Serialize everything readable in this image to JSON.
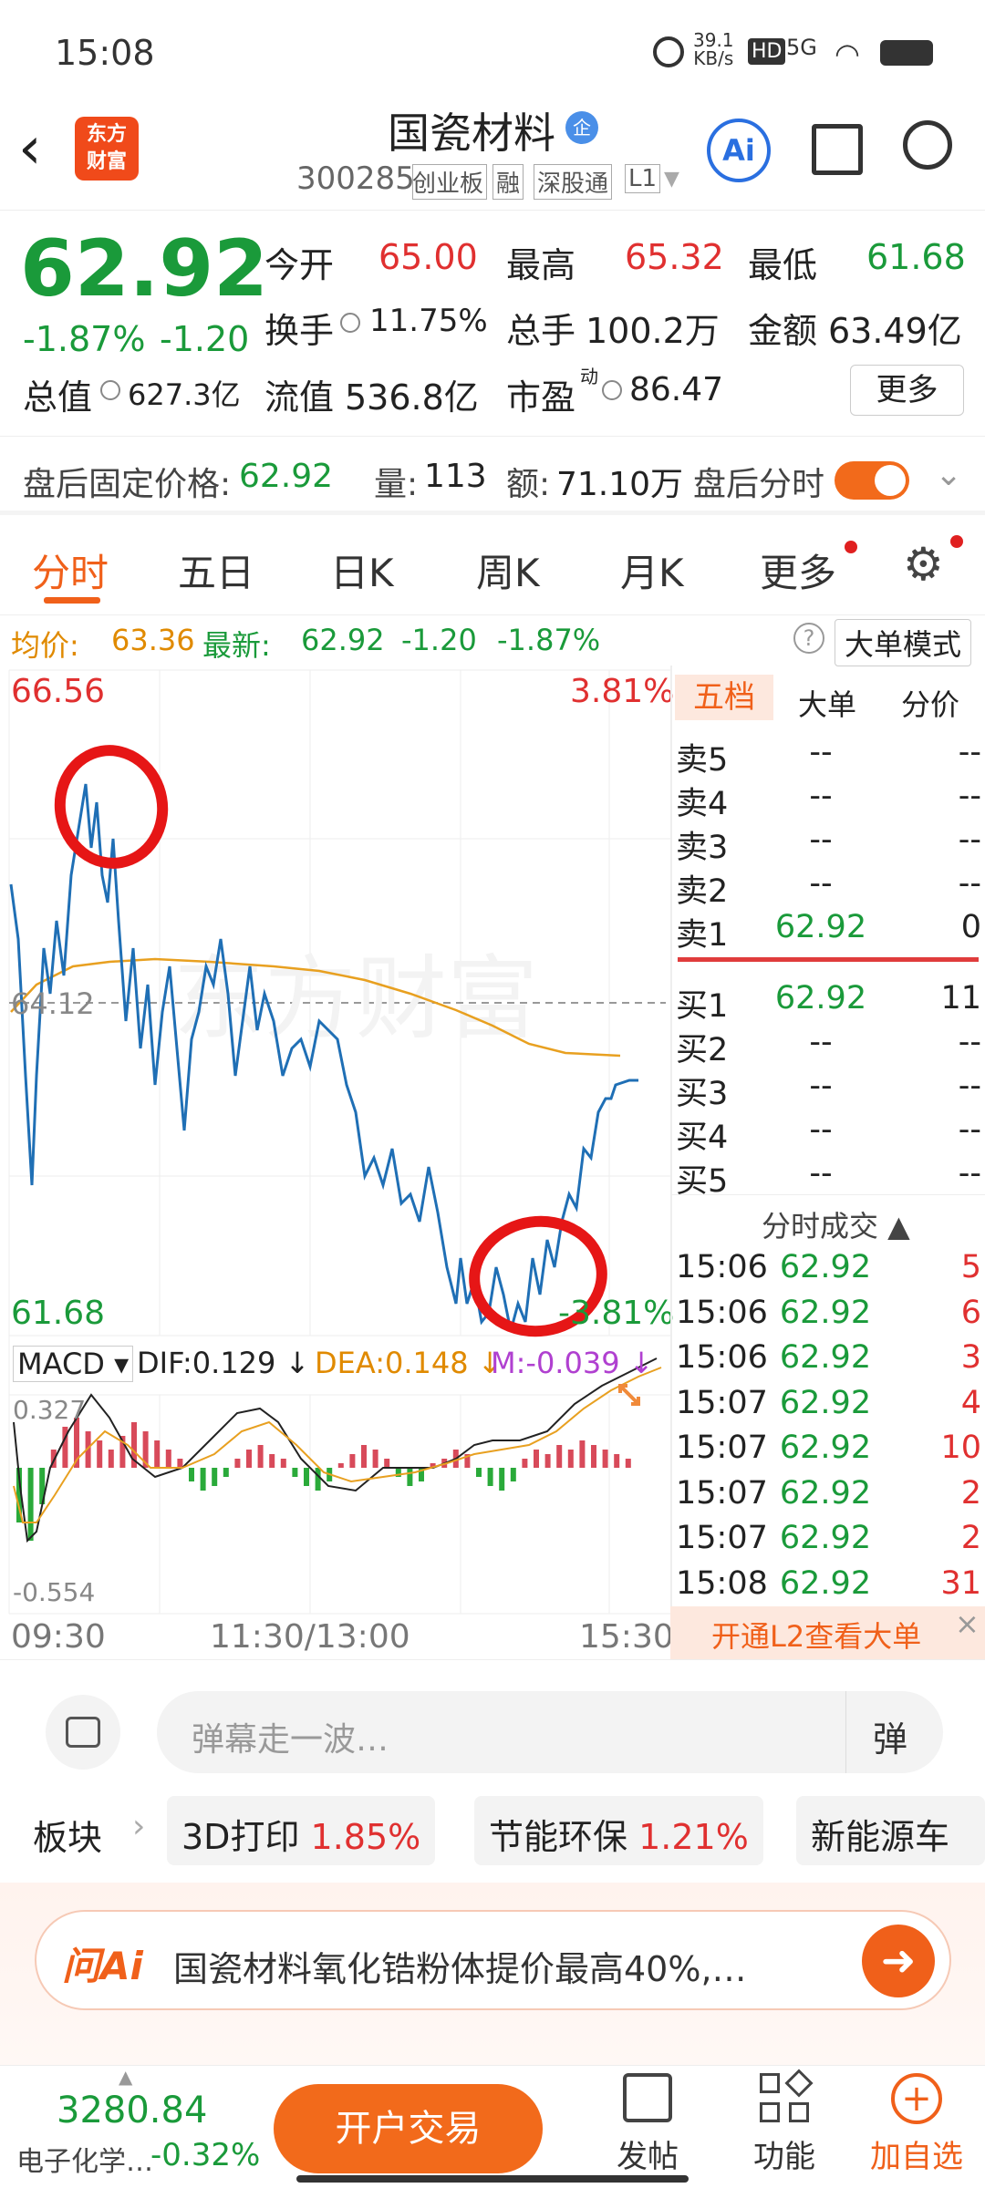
{
  "status": {
    "time": "15:08",
    "speed_value": "39.1",
    "speed_unit": "KB/s",
    "hd": "HD",
    "net": "5G"
  },
  "header": {
    "logo_line1": "东方",
    "logo_line2": "财富",
    "name": "国瓷材料",
    "name_badge": "企",
    "code": "300285",
    "tag1": "创业板",
    "tag2": "融",
    "tag3": "深股通",
    "tag4": "L1",
    "ai": "Ai"
  },
  "quote": {
    "price": "62.92",
    "pct": "-1.87%",
    "change": "-1.20",
    "open_label": "今开",
    "open": "65.00",
    "high_label": "最高",
    "high": "65.32",
    "low_label": "最低",
    "low": "61.68",
    "turnover_label": "换手",
    "turnover": "11.75%",
    "volume_label": "总手",
    "volume": "100.2万",
    "amount_label": "金额",
    "amount": "63.49亿",
    "mcap_label": "总值",
    "mcap": "627.3亿",
    "float_label": "流值",
    "float": "536.8亿",
    "pe_label": "市盈",
    "pe_sup": "动",
    "pe": "86.47",
    "more": "更多"
  },
  "after": {
    "label": "盘后固定价格:",
    "price": "62.92",
    "vol_label": "量:",
    "vol": "113",
    "amt_label": "额:",
    "amt": "71.10万",
    "toggle_label": "盘后分时"
  },
  "tabs": [
    "分时",
    "五日",
    "日K",
    "周K",
    "月K",
    "更多"
  ],
  "info": {
    "avg_label": "均价:",
    "avg": "63.36",
    "latest_label": "最新:",
    "latest": "62.92",
    "chg": "-1.20",
    "pct": "-1.87%",
    "mode": "大单模式"
  },
  "chart": {
    "max": "66.56",
    "max_pct": "3.81%",
    "min": "61.68",
    "min_pct": "-3.81%",
    "mid": "64.12",
    "watermark": "东方财富",
    "macd_label": "MACD",
    "dif": "DIF:0.129 ↓",
    "dea": "DEA:0.148 ↓",
    "m": "M:-0.039 ↓",
    "macd_top": "0.327",
    "macd_bottom": "-0.554",
    "t0": "09:30",
    "t1": "11:30/13:00",
    "t2": "15:30"
  },
  "book": {
    "tabs": [
      "五档",
      "大单",
      "分价"
    ],
    "asks": [
      {
        "l": "卖5",
        "p": "--",
        "v": "--"
      },
      {
        "l": "卖4",
        "p": "--",
        "v": "--"
      },
      {
        "l": "卖3",
        "p": "--",
        "v": "--"
      },
      {
        "l": "卖2",
        "p": "--",
        "v": "--"
      },
      {
        "l": "卖1",
        "p": "62.92",
        "v": "0"
      }
    ],
    "bids": [
      {
        "l": "买1",
        "p": "62.92",
        "v": "11"
      },
      {
        "l": "买2",
        "p": "--",
        "v": "--"
      },
      {
        "l": "买3",
        "p": "--",
        "v": "--"
      },
      {
        "l": "买4",
        "p": "--",
        "v": "--"
      },
      {
        "l": "买5",
        "p": "--",
        "v": "--"
      }
    ],
    "trades_title": "分时成交 ▲",
    "trades": [
      {
        "t": "15:06",
        "p": "62.92",
        "v": "5"
      },
      {
        "t": "15:06",
        "p": "62.92",
        "v": "6"
      },
      {
        "t": "15:06",
        "p": "62.92",
        "v": "3"
      },
      {
        "t": "15:07",
        "p": "62.92",
        "v": "4"
      },
      {
        "t": "15:07",
        "p": "62.92",
        "v": "10"
      },
      {
        "t": "15:07",
        "p": "62.92",
        "v": "2"
      },
      {
        "t": "15:07",
        "p": "62.92",
        "v": "2"
      },
      {
        "t": "15:08",
        "p": "62.92",
        "v": "31"
      }
    ],
    "l2": "开通L2查看大单"
  },
  "danmu": {
    "placeholder": "弹幕走一波…",
    "btn": "弹"
  },
  "sectors": {
    "label": "板块",
    "items": [
      {
        "name": "3D打印",
        "pct": "1.85%"
      },
      {
        "name": "节能环保",
        "pct": "1.21%"
      },
      {
        "name": "新能源车",
        "pct": ""
      }
    ]
  },
  "ai": {
    "logo": "问Ai",
    "text": "国瓷材料氧化锆粉体提价最高40%,…"
  },
  "bottom": {
    "index": "3280.84",
    "index_name": "电子化学…",
    "index_pct": "-0.32%",
    "trade": "开户交易",
    "post": "发帖",
    "func": "功能",
    "add": "加自选"
  }
}
